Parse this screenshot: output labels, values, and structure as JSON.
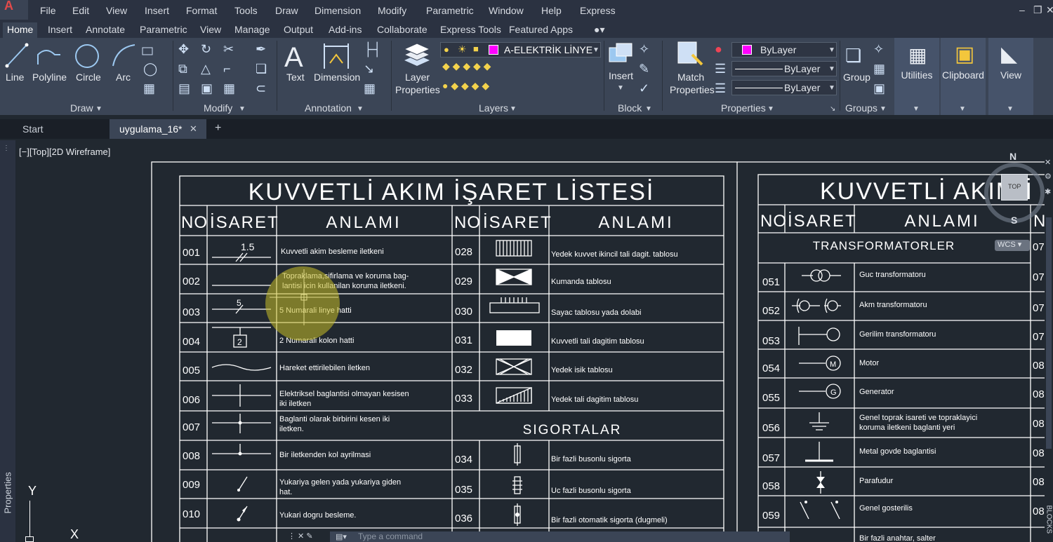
{
  "menu": {
    "items": [
      "File",
      "Edit",
      "View",
      "Insert",
      "Format",
      "Tools",
      "Draw",
      "Dimension",
      "Modify",
      "Parametric",
      "Window",
      "Help",
      "Express"
    ]
  },
  "ribbon": {
    "tabs": [
      "Home",
      "Insert",
      "Annotate",
      "Parametric",
      "View",
      "Manage",
      "Output",
      "Add-ins",
      "Collaborate",
      "Express Tools",
      "Featured Apps"
    ],
    "draw": {
      "line": "Line",
      "polyline": "Polyline",
      "circle": "Circle",
      "arc": "Arc",
      "title": "Draw"
    },
    "modify": {
      "title": "Modify"
    },
    "annotation": {
      "text": "Text",
      "dimension": "Dimension",
      "title": "Annotation"
    },
    "layers": {
      "layer_properties_1": "Layer",
      "layer_properties_2": "Properties",
      "current_layer": "A-ELEKTRİK LİNYE",
      "title": "Layers"
    },
    "block": {
      "insert": "Insert",
      "title": "Block"
    },
    "properties": {
      "match_1": "Match",
      "match_2": "Properties",
      "color": "ByLayer",
      "linetype": "ByLayer",
      "lineweight": "ByLayer",
      "title": "Properties"
    },
    "groups": {
      "group": "Group",
      "title": "Groups"
    },
    "utilities": "Utilities",
    "clipboard": "Clipboard",
    "view": "View"
  },
  "doc_tabs": {
    "start": "Start",
    "file": "uygulama_16*"
  },
  "viewport_label": "[−][Top][2D Wireframe]",
  "properties_palette": "Properties",
  "compass": {
    "n": "N",
    "s": "S",
    "top": "TOP",
    "wcs": "WCS"
  },
  "command_placeholder": "Type a command",
  "ucs": {
    "y": "Y",
    "x": "X"
  },
  "blocks_label": "BLOCKS",
  "sheet": {
    "title": "KUVVETLİ AKIM İŞARET LİSTESİ",
    "title2": "KUVVETLİ AKIM İ",
    "col_no": "NO",
    "col_isaret": "İSARET",
    "col_anlami": "ANLAMI",
    "left_rows": [
      {
        "no": "001",
        "text": "Kuvvetli akim besleme iletkeni"
      },
      {
        "no": "002",
        "text": "Topraklama,sifirlama ve koruma bag-",
        "text2": "lantisi icin kullanilan koruma iletkeni."
      },
      {
        "no": "003",
        "text": "5 Numarali linye hatti"
      },
      {
        "no": "004",
        "text": "2 Numarali kolon hatti"
      },
      {
        "no": "005",
        "text": "Hareket ettirilebilen iletken"
      },
      {
        "no": "006",
        "text": "Elektriksel baglantisi olmayan kesisen",
        "text2": "iki iletken"
      },
      {
        "no": "007",
        "text": "Baglanti olarak birbirini kesen iki",
        "text2": "iletken."
      },
      {
        "no": "008",
        "text": "Bir iletkenden kol ayrilmasi"
      },
      {
        "no": "009",
        "text": "Yukariya gelen yada yukariya giden",
        "text2": "hat."
      },
      {
        "no": "010",
        "text": "Yukari dogru besleme."
      }
    ],
    "mid_rows": [
      {
        "no": "028",
        "text": "Yedek kuvvet ikincil tali dagit. tablosu"
      },
      {
        "no": "029",
        "text": "Kumanda tablosu"
      },
      {
        "no": "030",
        "text": "Sayac tablosu yada dolabi"
      },
      {
        "no": "031",
        "text": "Kuvvetli tali dagitim tablosu"
      },
      {
        "no": "032",
        "text": "Yedek isik tablosu"
      },
      {
        "no": "033",
        "text": "Yedek tali dagitim tablosu"
      }
    ],
    "sigortalar": "SIGORTALAR",
    "fuse_rows": [
      {
        "no": "034",
        "text": "Bir fazli busonlu sigorta"
      },
      {
        "no": "035",
        "text": "Uc fazli busonlu sigorta"
      },
      {
        "no": "036",
        "text": "Bir fazli otomatik sigorta (dugmeli)"
      }
    ],
    "transformatorler": "TRANSFORMATORLER",
    "right_rows": [
      {
        "no": "051",
        "text": "Guc transformatoru"
      },
      {
        "no": "052",
        "text": "Akm transformatoru"
      },
      {
        "no": "053",
        "text": "Gerilim transformatoru"
      },
      {
        "no": "054",
        "text": "Motor"
      },
      {
        "no": "055",
        "text": "Generator"
      },
      {
        "no": "056",
        "text": "Genel toprak isareti ve topraklayici",
        "text2": "koruma iletkeni baglanti yeri"
      },
      {
        "no": "057",
        "text": "Metal govde baglantisi"
      },
      {
        "no": "058",
        "text": "Parafudur"
      },
      {
        "no": "059",
        "text": "Genel gosterilis"
      },
      {
        "no": "",
        "text": "Bir fazli anahtar, salter"
      }
    ],
    "sym_labels": {
      "v15": "1.5",
      "v5": "5",
      "v2": "2",
      "m": "M",
      "g": "G"
    },
    "edge_nos": [
      "07",
      "07",
      "07",
      "07",
      "08",
      "08",
      "08",
      "08",
      "08",
      "08",
      "08",
      "08"
    ]
  }
}
